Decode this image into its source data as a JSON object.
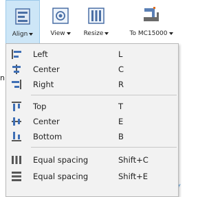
{
  "ribbon": {
    "align_label": "Align",
    "view_label": "View",
    "resize_label": "Resize",
    "to_mc_label": "To MC15000"
  },
  "menu": {
    "items": [
      {
        "label": "Left",
        "shortcut": "L",
        "icon": "align-left-icon"
      },
      {
        "label": "Center",
        "shortcut": "C",
        "icon": "align-center-horizontal-icon"
      },
      {
        "label": "Right",
        "shortcut": "R",
        "icon": "align-right-icon"
      },
      {
        "label": "Top",
        "shortcut": "T",
        "icon": "align-top-icon"
      },
      {
        "label": "Center",
        "shortcut": "E",
        "icon": "align-center-vertical-icon"
      },
      {
        "label": "Bottom",
        "shortcut": "B",
        "icon": "align-bottom-icon"
      },
      {
        "label": "Equal spacing",
        "shortcut": "Shift+C",
        "icon": "equal-spacing-horizontal-icon"
      },
      {
        "label": "Equal spacing",
        "shortcut": "Shift+E",
        "icon": "equal-spacing-vertical-icon"
      }
    ]
  },
  "background": {
    "partial_char_left": "n",
    "partial_char_right": "f"
  },
  "colors": {
    "selected_button_bg": "#cde6f7",
    "icon_blue": "#3f6fb5",
    "icon_gray": "#5a5a5a",
    "menu_bg": "#f2f2f2"
  }
}
